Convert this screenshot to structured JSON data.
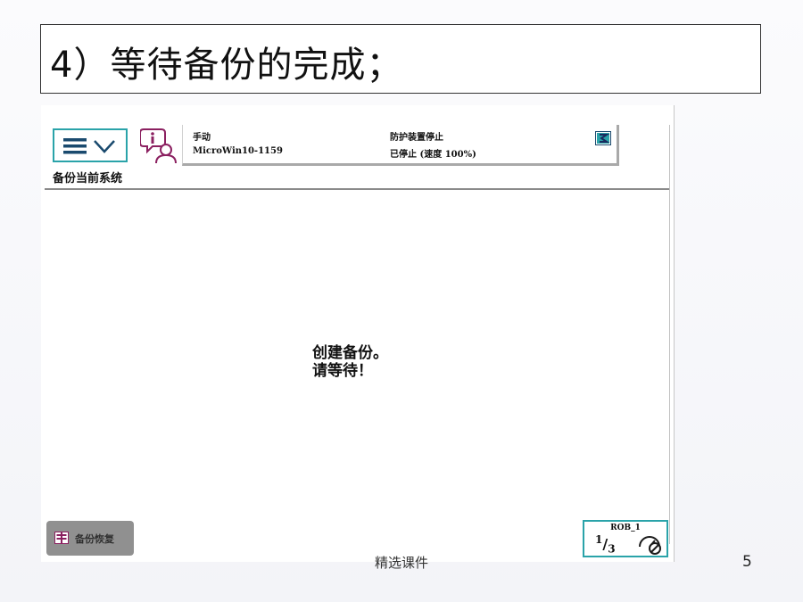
{
  "slide": {
    "title": "4）等待备份的完成；",
    "footer": "精选课件",
    "page_number": "5"
  },
  "pendant": {
    "header": {
      "mode": "手动",
      "system_name": "MicroWin10-1159",
      "safety_status": "防护装置停止",
      "speed_status": "已停止 (速度 100%)"
    },
    "window_title": "备份当前系统",
    "message": {
      "line1": "创建备份。",
      "line2": "请等待！"
    },
    "taskbar": {
      "button_label": "备份恢复"
    },
    "quickset": {
      "unit": "ROB_1"
    },
    "colors": {
      "accent": "#2aa3a9",
      "info_icon": "#8b2060"
    }
  }
}
